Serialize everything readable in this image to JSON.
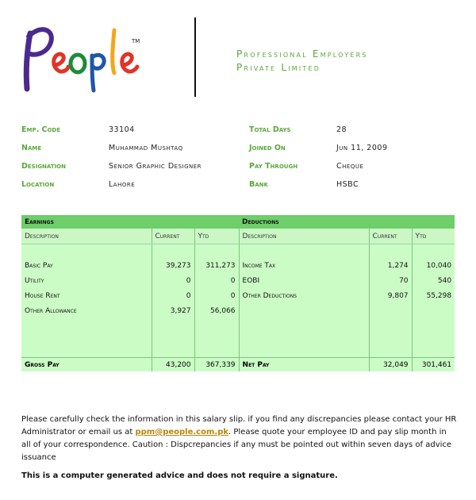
{
  "logo_text": "People",
  "logo_tm": "TM",
  "company": {
    "line1": "Professional Employers",
    "line2": "Private Limited"
  },
  "employee": {
    "emp_code_label": "Emp. Code",
    "emp_code": "33104",
    "name_label": "Name",
    "name": "Muhammad Mushtaq",
    "designation_label": "Designation",
    "designation": "Senior Graphic Designer",
    "location_label": "Location",
    "location": "Lahore",
    "total_days_label": "Total Days",
    "total_days": "28",
    "joined_on_label": "Joined On",
    "joined_on": "Jun 11, 2009",
    "pay_through_label": "Pay Through",
    "pay_through": "Cheque",
    "bank_label": "Bank",
    "bank": "HSBC"
  },
  "salary": {
    "earnings_title": "Earnings",
    "deductions_title": "Deductions",
    "col_description": "Description",
    "col_current": "Current",
    "col_ytd": "Ytd",
    "earnings": [
      {
        "desc": "Basic Pay",
        "current": "39,273",
        "ytd": "311,273"
      },
      {
        "desc": "Utility",
        "current": "0",
        "ytd": "0"
      },
      {
        "desc": "House Rent",
        "current": "0",
        "ytd": "0"
      },
      {
        "desc": "Other Allowance",
        "current": "3,927",
        "ytd": "56,066"
      }
    ],
    "deductions": [
      {
        "desc": "Income Tax",
        "current": "1,274",
        "ytd": "10,040"
      },
      {
        "desc": "EOBI",
        "current": "70",
        "ytd": "540"
      },
      {
        "desc": "Other Deductions",
        "current": "9,807",
        "ytd": "55,298"
      }
    ],
    "gross_pay_label": "Gross Pay",
    "gross_current": "43,200",
    "gross_ytd": "367,339",
    "net_pay_label": "Net Pay",
    "net_current": "32,049",
    "net_ytd": "301,461"
  },
  "note": {
    "text1": "Please carefully check the information in this salary slip. if you find any discrepancies please contact your HR Administrator or email us at ",
    "email": "ppm@people.com.pk",
    "text2": ". Please quote your employee ID and pay slip month in all of your correspondence. Caution : Dispcrepancies if any must be pointed out within seven days of advice issuance"
  },
  "disclaimer": "This is a computer generated advice and does not require a signature.",
  "colors": {
    "accent_green": "#5aa83a",
    "table_header": "#6dce6a",
    "table_body": "#cbfcc5",
    "link_gold": "#b8860b"
  }
}
